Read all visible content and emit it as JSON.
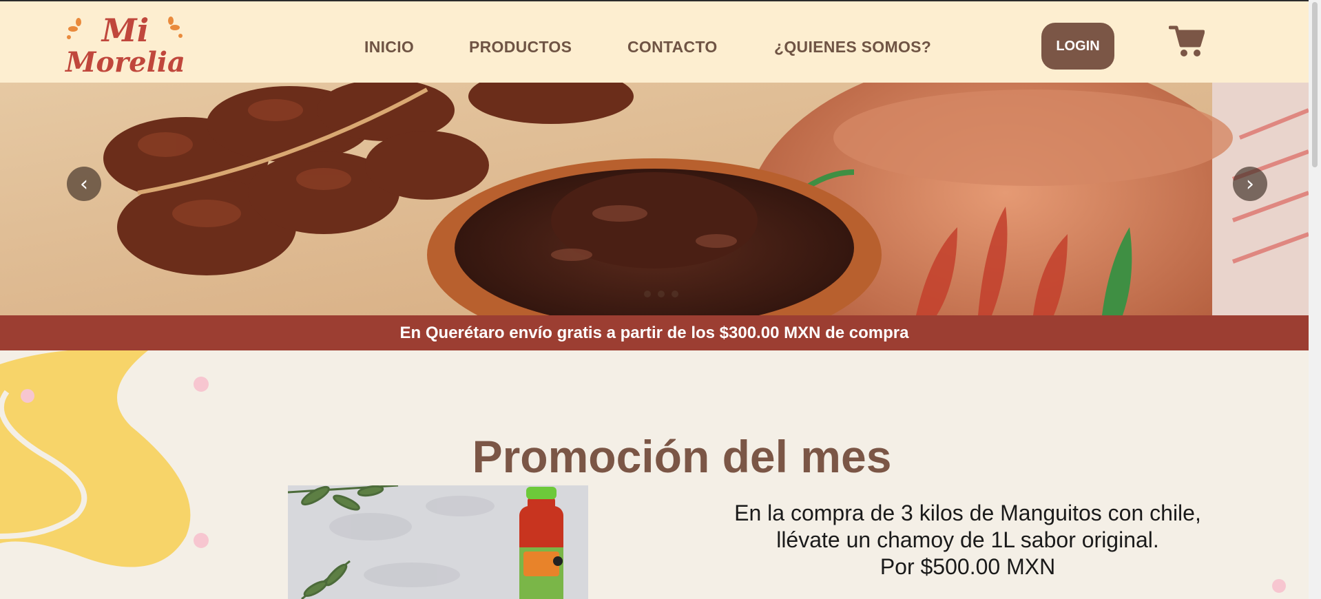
{
  "brand": {
    "logo_line1": "Mi",
    "logo_line2": "Morelia"
  },
  "nav": {
    "items": [
      {
        "label": "INICIO"
      },
      {
        "label": "PRODUCTOS"
      },
      {
        "label": "CONTACTO"
      },
      {
        "label": "¿QUIENES SOMOS?"
      }
    ],
    "login_label": "LOGIN",
    "cart_icon": "cart-icon"
  },
  "carousel": {
    "prev_label": "‹",
    "next_label": "›",
    "slides": 3,
    "active_slide": 1
  },
  "banner": {
    "text": "En Querétaro envío gratis a partir de los $300.00 MXN de compra"
  },
  "promo": {
    "title": "Promoción del mes",
    "lines": [
      "En la compra de 3 kilos de Manguitos con chile,",
      "llévate un chamoy de 1L sabor original.",
      "Por $500.00 MXN"
    ]
  },
  "colors": {
    "header_bg": "#fdeed0",
    "accent_brown": "#7b5646",
    "banner_red": "#9c3e32",
    "page_bg": "#f4efe6",
    "logo_red": "#c0473c"
  }
}
